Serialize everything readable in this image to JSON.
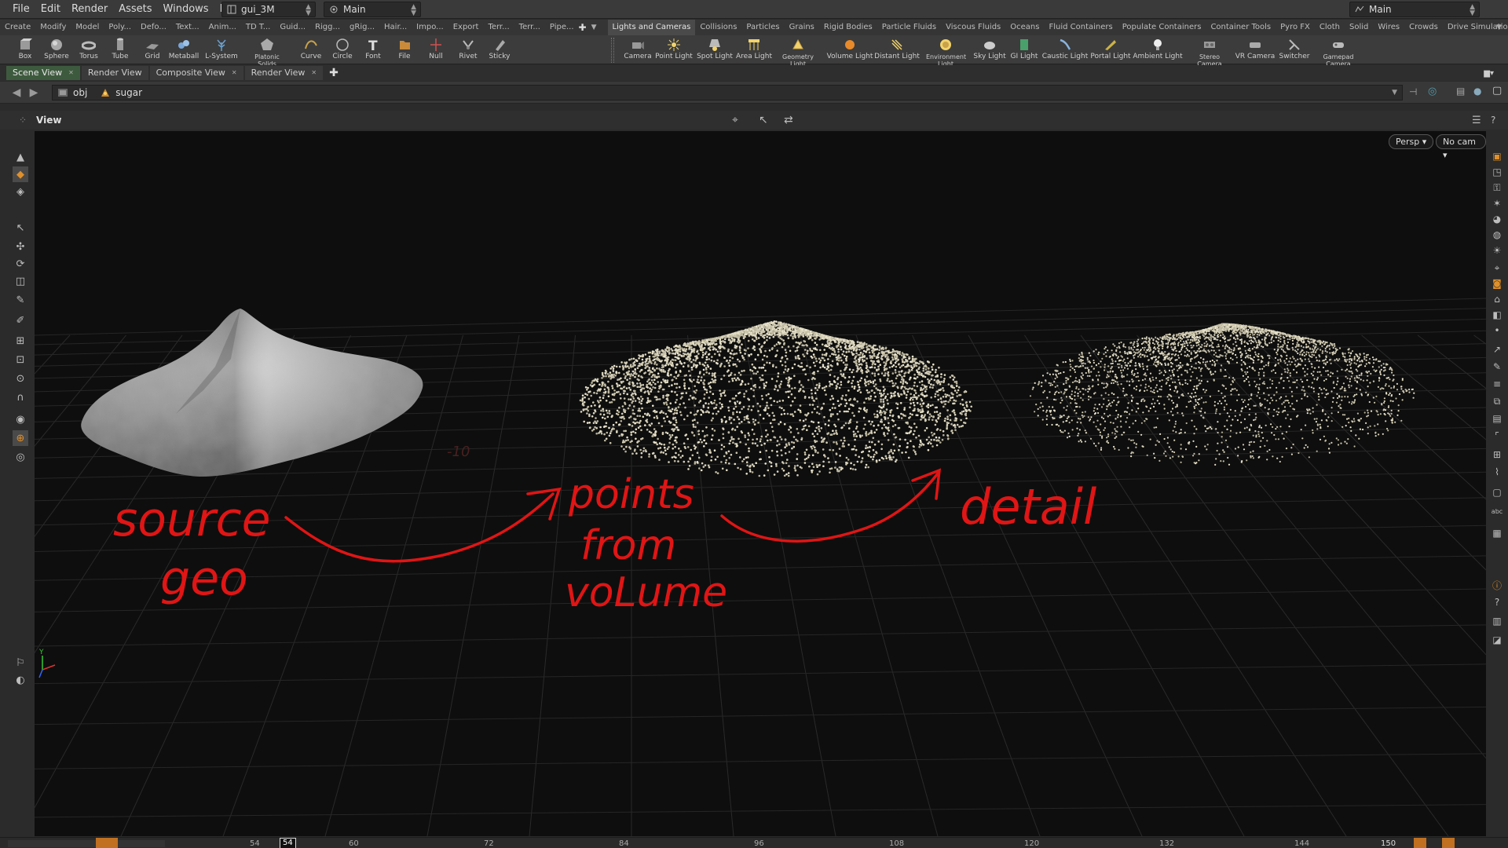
{
  "menubar": {
    "items": [
      "File",
      "Edit",
      "Render",
      "Assets",
      "Windows",
      "Help"
    ],
    "desktop": "gui_3M",
    "network": "Main",
    "right_desktop": "Main"
  },
  "shelf_tabs_left": [
    "Create",
    "Modify",
    "Model",
    "Poly...",
    "Defo...",
    "Text...",
    "Anim...",
    "TD T...",
    "Guid...",
    "Rigg...",
    "gRig...",
    "Hair...",
    "Impo...",
    "Export",
    "Terr...",
    "Terr...",
    "Pipe..."
  ],
  "shelf_tabs_right": [
    "Lights and Cameras",
    "Collisions",
    "Particles",
    "Grains",
    "Rigid Bodies",
    "Particle Fluids",
    "Viscous Fluids",
    "Oceans",
    "Fluid Containers",
    "Populate Containers",
    "Container Tools",
    "Pyro FX",
    "Cloth",
    "Solid",
    "Wires",
    "Crowds",
    "Drive Simulation"
  ],
  "tools_left": [
    {
      "label": "Box",
      "icon": "box-icon"
    },
    {
      "label": "Sphere",
      "icon": "sphere-icon"
    },
    {
      "label": "Torus",
      "icon": "torus-icon"
    },
    {
      "label": "Tube",
      "icon": "tube-icon"
    },
    {
      "label": "Grid",
      "icon": "grid-icon"
    },
    {
      "label": "Metaball",
      "icon": "metaball-icon"
    },
    {
      "label": "L-System",
      "icon": "lsystem-icon"
    },
    {
      "label": "Platonic Solids",
      "icon": "platonic-icon"
    },
    {
      "label": "Curve",
      "icon": "curve-icon"
    },
    {
      "label": "Circle",
      "icon": "circle-icon"
    },
    {
      "label": "Font",
      "icon": "font-icon"
    },
    {
      "label": "File",
      "icon": "file-icon"
    },
    {
      "label": "Null",
      "icon": "null-icon"
    },
    {
      "label": "Rivet",
      "icon": "rivet-icon"
    },
    {
      "label": "Sticky",
      "icon": "sticky-icon"
    }
  ],
  "tools_right": [
    {
      "label": "Camera",
      "icon": "camera-icon"
    },
    {
      "label": "Point Light",
      "icon": "point-light-icon"
    },
    {
      "label": "Spot Light",
      "icon": "spot-light-icon"
    },
    {
      "label": "Area Light",
      "icon": "area-light-icon"
    },
    {
      "label": "Geometry Light",
      "icon": "geometry-light-icon"
    },
    {
      "label": "Volume Light",
      "icon": "volume-light-icon"
    },
    {
      "label": "Distant Light",
      "icon": "distant-light-icon"
    },
    {
      "label": "Environment Light",
      "icon": "environment-light-icon"
    },
    {
      "label": "Sky Light",
      "icon": "sky-light-icon"
    },
    {
      "label": "GI Light",
      "icon": "gi-light-icon"
    },
    {
      "label": "Caustic Light",
      "icon": "caustic-light-icon"
    },
    {
      "label": "Portal Light",
      "icon": "portal-light-icon"
    },
    {
      "label": "Ambient Light",
      "icon": "ambient-light-icon"
    },
    {
      "label": "Stereo Camera",
      "icon": "stereo-camera-icon"
    },
    {
      "label": "VR Camera",
      "icon": "vr-camera-icon"
    },
    {
      "label": "Switcher",
      "icon": "switcher-icon"
    },
    {
      "label": "Gamepad Camera",
      "icon": "gamepad-camera-icon"
    }
  ],
  "pane_tabs": [
    {
      "label": "Scene View",
      "selected": true
    },
    {
      "label": "Render View",
      "selected": false
    },
    {
      "label": "Composite View",
      "selected": false
    },
    {
      "label": "Render View",
      "selected": false
    }
  ],
  "path": {
    "root": "obj",
    "node": "sugar"
  },
  "view": {
    "title": "View",
    "projection": "Persp ▾",
    "camera": "No cam ▾",
    "grid_label": "-10"
  },
  "annotations": {
    "label1_line1": "source",
    "label1_line2": "geo",
    "label2_line1": "points",
    "label2_line2": "from",
    "label2_line3": "voLume",
    "label3": "detail",
    "color": "#e01515"
  },
  "timeline": {
    "start": "54",
    "current": "54",
    "ticks": [
      "60",
      "72",
      "84",
      "96",
      "108",
      "120",
      "132",
      "144"
    ],
    "end": "150"
  },
  "colors": {
    "accent_tab": "#3e5a3e",
    "viewport_bg": "#0e0e0e",
    "sand": "#d8d2b6"
  }
}
